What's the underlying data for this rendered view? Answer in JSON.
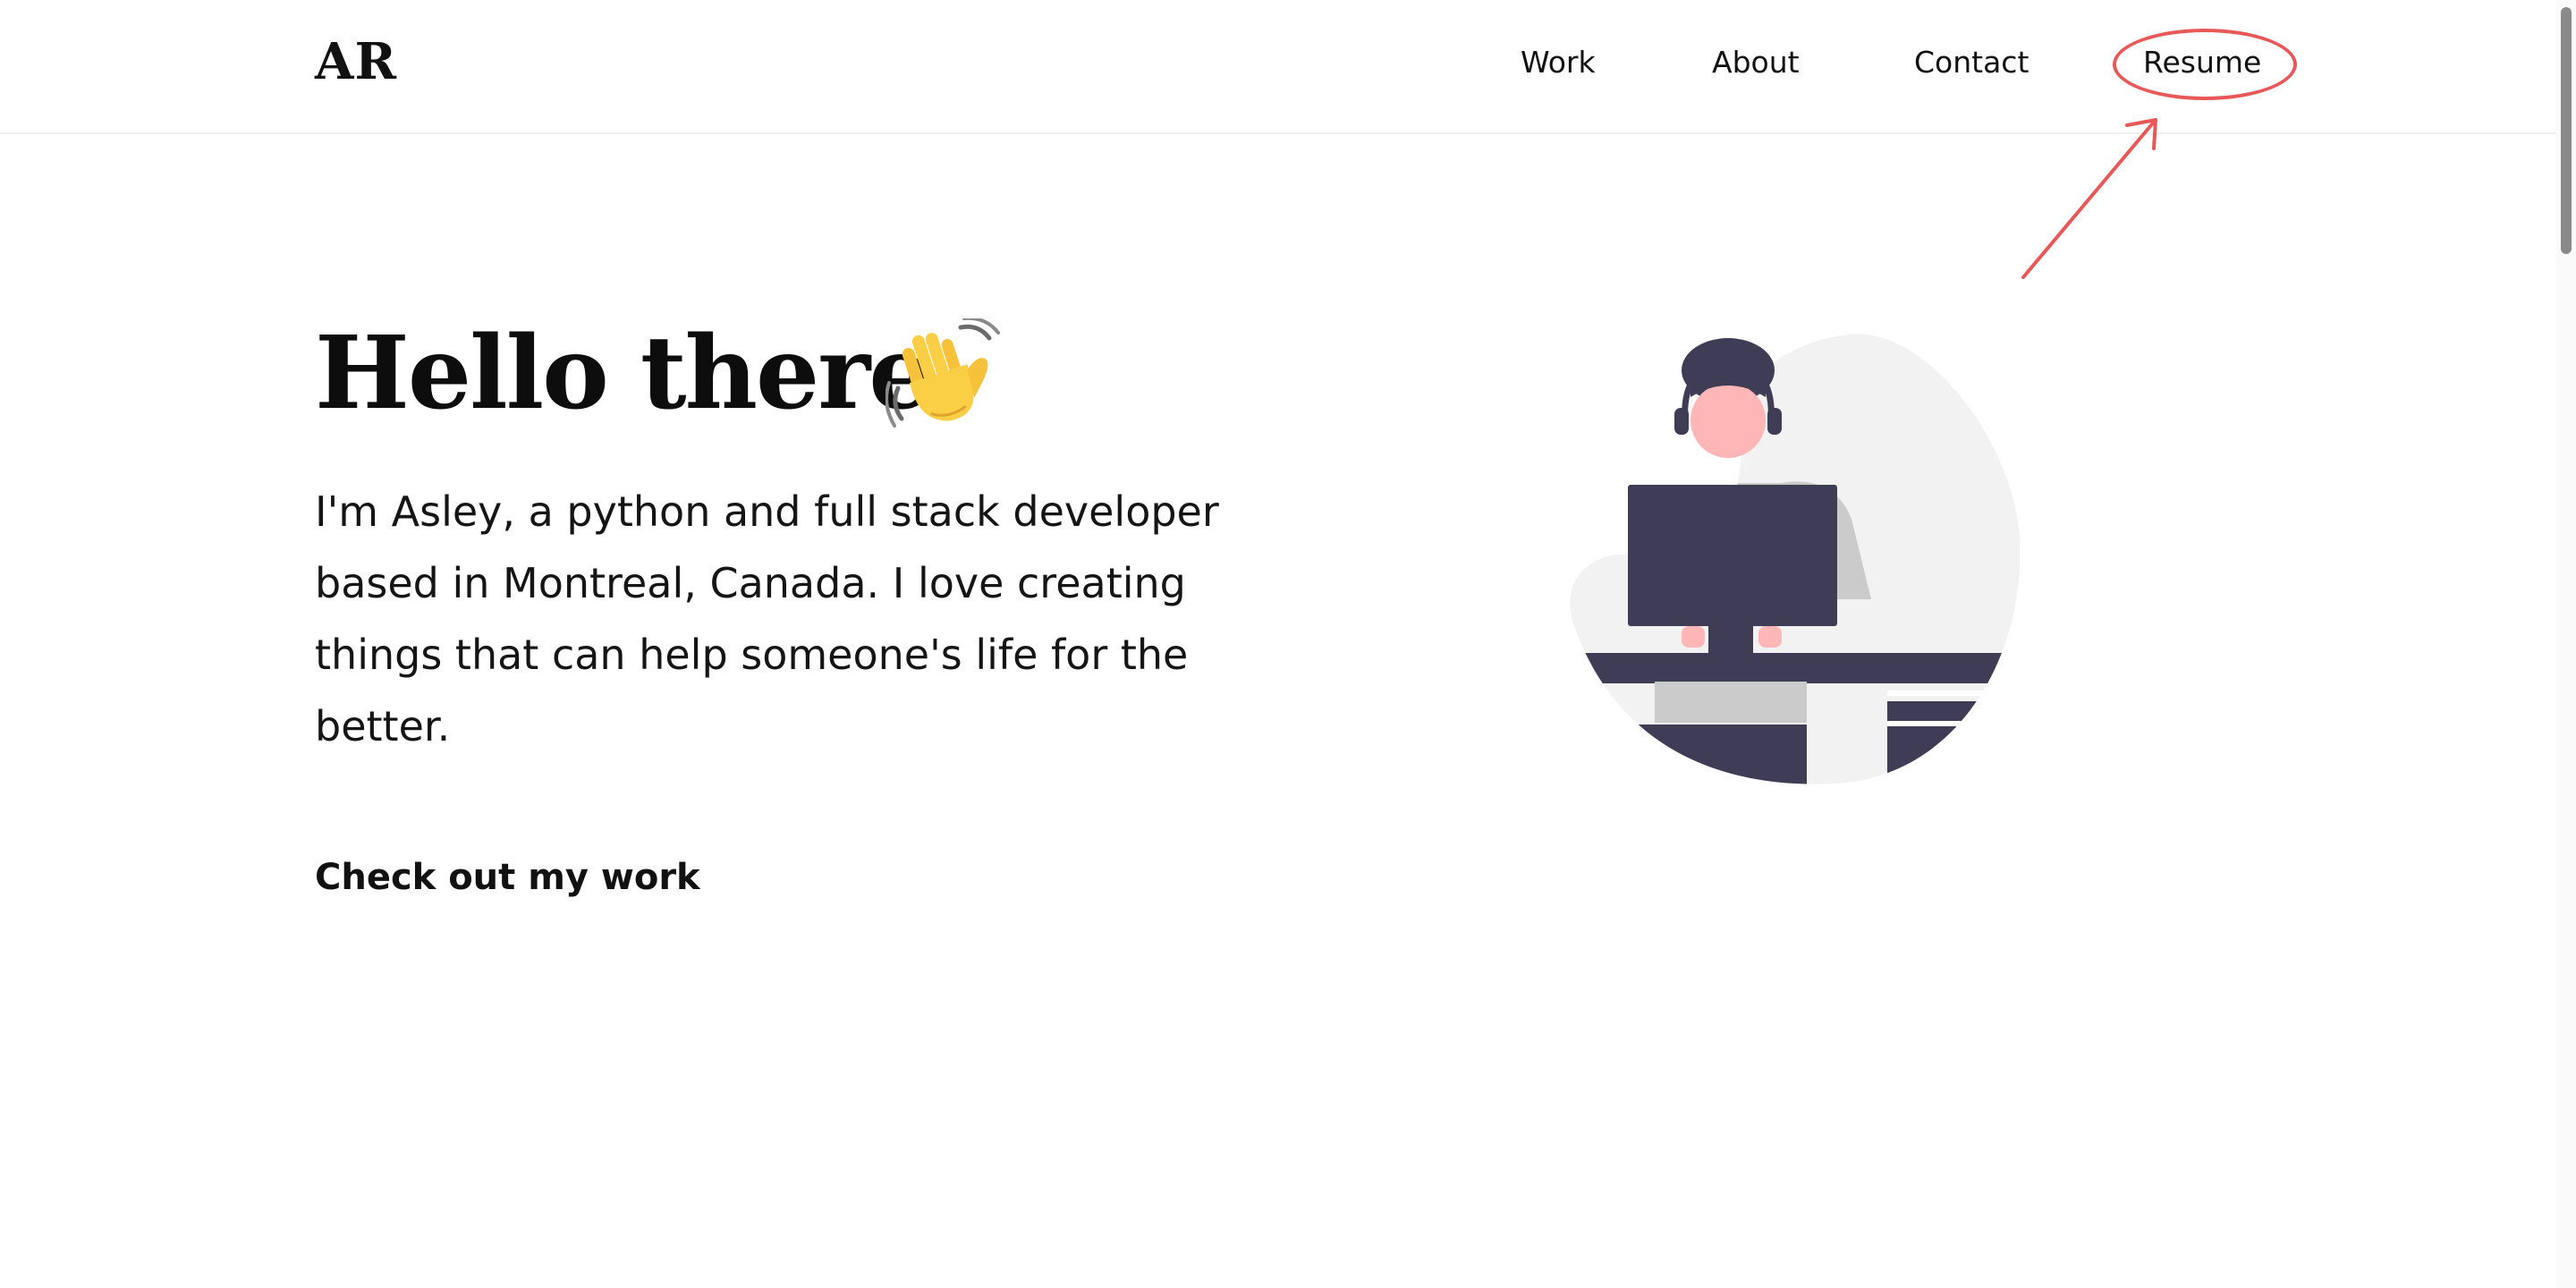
{
  "header": {
    "logo": "AR",
    "nav": [
      {
        "label": "Work"
      },
      {
        "label": "About"
      },
      {
        "label": "Contact"
      },
      {
        "label": "Resume"
      }
    ]
  },
  "hero": {
    "title": "Hello there",
    "intro": "I'm Asley, a python and full stack developer based in Montreal, Canada. I love creating things that can help someone's life for the better.",
    "cta": "Check out my work"
  },
  "icons": {
    "wave": "waving-hand-icon",
    "illustration": "developer-at-computer-illustration"
  },
  "colors": {
    "annotation": "#e85858",
    "text": "#111111",
    "illustration_dark": "#3f3d56",
    "illustration_skin": "#ffb6b6",
    "illustration_light": "#f2f2f2"
  }
}
